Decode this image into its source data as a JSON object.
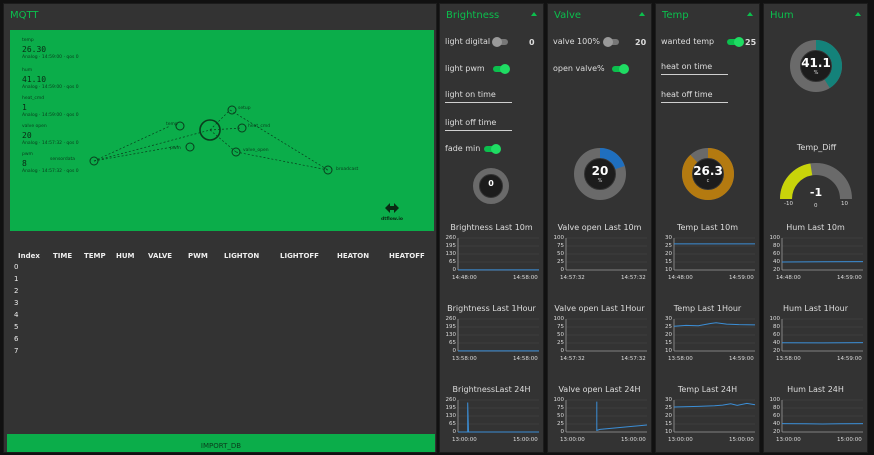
{
  "mqtt": {
    "title": "MQTT",
    "import_label": "IMPORT_DB",
    "flow": {
      "readings": [
        {
          "label": "temp",
          "value": "26.30",
          "meta": "Analog · 14:59:00 · qos 0"
        },
        {
          "label": "hum",
          "value": "41.10",
          "meta": "Analog · 14:59:00 · qos 0"
        },
        {
          "label": "heat_cmd",
          "value": "1",
          "meta": "Analog · 14:59:00 · qos 0"
        },
        {
          "label": "valve open",
          "value": "20",
          "meta": "Analog · 14:57:32 · qos 0"
        },
        {
          "label": "pwm",
          "value": "8",
          "meta": "Analog · 14:57:32 · qos 0"
        }
      ],
      "nodes": [
        "temp",
        "setup",
        "pwm",
        "heat_cmd",
        "valve_open",
        "sensordata",
        "light",
        "broadcast"
      ],
      "logo_label": "dtflow.io"
    },
    "table": {
      "headers": [
        "Index",
        "TIME",
        "TEMP",
        "HUM",
        "VALVE",
        "PWM",
        "LIGHTON",
        "LIGHTOFF",
        "HEATON",
        "HEATOFF"
      ],
      "indexes": [
        "0",
        "1",
        "2",
        "3",
        "4",
        "5",
        "6",
        "7"
      ]
    }
  },
  "brightness": {
    "title": "Brightness",
    "light_digital_label": "light digital",
    "light_digital_value": "0",
    "light_pwm_label": "light pwm",
    "light_on_time_label": "light on time",
    "light_off_time_label": "light off time",
    "fade_min_label": "fade min",
    "gauge_value": "0"
  },
  "valve": {
    "title": "Valve",
    "valve_label": "valve 100%",
    "valve_value": "20",
    "open_valve_label": "open valve%",
    "gauge_value": "20",
    "gauge_unit": "%",
    "gauge_fraction": 0.2
  },
  "temp": {
    "title": "Temp",
    "wanted_label": "wanted temp",
    "wanted_value": "25",
    "heat_on_label": "heat on time",
    "heat_off_label": "heat off time",
    "gauge_value": "26.3",
    "gauge_unit": "c",
    "gauge_fraction": 0.88
  },
  "hum": {
    "title": "Hum",
    "gauge_value": "41.1",
    "gauge_unit": "%",
    "gauge_fraction": 0.41,
    "diff_title": "Temp_Diff",
    "diff_value": "-1",
    "diff_min": "-10",
    "diff_mid": "0",
    "diff_max": "10",
    "diff_fraction": 0.45
  },
  "colors": {
    "accent": "#0bbf4d",
    "valve_gauge": "#1f6fbf",
    "temp_gauge": "#b47a10",
    "hum_gauge": "#14827a",
    "diff_gauge": "#c8d40a",
    "line": "#3b8ed6"
  },
  "chart_data": [
    {
      "type": "line",
      "title": "Brightness Last 10m",
      "yticks": [
        "260",
        "195",
        "130",
        "65",
        "0"
      ],
      "xticks": [
        "14:48:00",
        "14:58:00"
      ],
      "ylim": [
        0,
        260
      ],
      "series": [
        {
          "x": [
            0,
            1
          ],
          "values": [
            1,
            1
          ]
        }
      ]
    },
    {
      "type": "line",
      "title": "Brightness Last 1Hour",
      "yticks": [
        "260",
        "195",
        "130",
        "65",
        "0"
      ],
      "xticks": [
        "13:58:00",
        "14:58:00"
      ],
      "ylim": [
        0,
        260
      ],
      "series": [
        {
          "x": [
            0,
            1
          ],
          "values": [
            1,
            1
          ]
        }
      ]
    },
    {
      "type": "line",
      "title": "BrightnessLast 24H",
      "yticks": [
        "260",
        "195",
        "130",
        "65",
        "0"
      ],
      "xticks": [
        "13:00:00",
        "15:00:00"
      ],
      "ylim": [
        0,
        260
      ],
      "series": [
        {
          "x": [
            0,
            0.12,
            0.12,
            0.13,
            1
          ],
          "values": [
            0,
            0,
            240,
            0,
            0
          ]
        }
      ]
    },
    {
      "type": "line",
      "title": "Valve open Last 10m",
      "yticks": [
        "100",
        "75",
        "50",
        "25",
        "0"
      ],
      "xticks": [
        "14:57:32",
        "14:57:32"
      ],
      "ylim": [
        0,
        100
      ],
      "series": [
        {
          "x": [],
          "values": []
        }
      ]
    },
    {
      "type": "line",
      "title": "Valve open Last 1Hour",
      "yticks": [
        "100",
        "75",
        "50",
        "25",
        "0"
      ],
      "xticks": [
        "14:57:32",
        "14:57:32"
      ],
      "ylim": [
        0,
        100
      ],
      "series": [
        {
          "x": [],
          "values": []
        }
      ]
    },
    {
      "type": "line",
      "title": "Valve open Last 24H",
      "yticks": [
        "100",
        "75",
        "50",
        "25",
        "0"
      ],
      "xticks": [
        "13:00:00",
        "15:00:00"
      ],
      "ylim": [
        0,
        100
      ],
      "series": [
        {
          "x": [
            0.38,
            0.38,
            0.42,
            1
          ],
          "values": [
            95,
            5,
            8,
            22
          ]
        }
      ]
    },
    {
      "type": "line",
      "title": "Temp Last 10m",
      "yticks": [
        "30",
        "25",
        "20",
        "15",
        "10"
      ],
      "xticks": [
        "14:48:00",
        "14:59:00"
      ],
      "ylim": [
        10,
        30
      ],
      "series": [
        {
          "x": [
            0,
            1
          ],
          "values": [
            26.3,
            26.3
          ]
        }
      ]
    },
    {
      "type": "line",
      "title": "Temp Last 1Hour",
      "yticks": [
        "30",
        "25",
        "20",
        "15",
        "10"
      ],
      "xticks": [
        "13:58:00",
        "14:59:00"
      ],
      "ylim": [
        10,
        30
      ],
      "series": [
        {
          "x": [
            0,
            0.15,
            0.3,
            0.45,
            0.52,
            0.65,
            0.8,
            1
          ],
          "values": [
            25.5,
            26.0,
            25.8,
            27.2,
            27.6,
            26.8,
            26.5,
            26.3
          ]
        }
      ]
    },
    {
      "type": "line",
      "title": "Temp Last 24H",
      "yticks": [
        "30",
        "25",
        "20",
        "15",
        "10"
      ],
      "xticks": [
        "13:00:00",
        "15:00:00"
      ],
      "ylim": [
        10,
        30
      ],
      "series": [
        {
          "x": [
            0,
            0.3,
            0.5,
            0.6,
            0.7,
            0.78,
            0.9,
            1
          ],
          "values": [
            25.6,
            26.0,
            26.4,
            26.8,
            27.6,
            26.6,
            27.9,
            27.0
          ]
        }
      ]
    },
    {
      "type": "line",
      "title": "Hum Last 10m",
      "yticks": [
        "100",
        "80",
        "60",
        "40",
        "20"
      ],
      "xticks": [
        "14:48:00",
        "14:59:00"
      ],
      "ylim": [
        20,
        100
      ],
      "series": [
        {
          "x": [
            0,
            0.5,
            1
          ],
          "values": [
            40,
            40.8,
            41.1
          ]
        }
      ]
    },
    {
      "type": "line",
      "title": "Hum Last 1Hour",
      "yticks": [
        "100",
        "80",
        "60",
        "40",
        "20"
      ],
      "xticks": [
        "13:58:00",
        "14:59:00"
      ],
      "ylim": [
        20,
        100
      ],
      "series": [
        {
          "x": [
            0,
            0.5,
            1
          ],
          "values": [
            40.5,
            40.2,
            41.1
          ]
        }
      ]
    },
    {
      "type": "line",
      "title": "Hum Last 24H",
      "yticks": [
        "100",
        "80",
        "60",
        "40",
        "20"
      ],
      "xticks": [
        "13:00:00",
        "15:00:00"
      ],
      "ylim": [
        20,
        100
      ],
      "series": [
        {
          "x": [
            0,
            0.3,
            0.5,
            0.7,
            1
          ],
          "values": [
            41,
            40.5,
            40,
            40.6,
            41
          ]
        }
      ]
    }
  ]
}
